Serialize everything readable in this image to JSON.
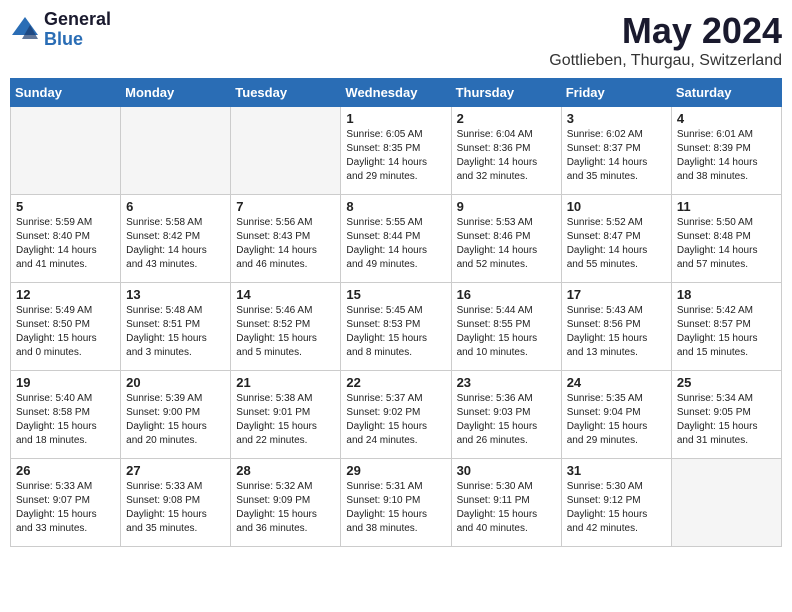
{
  "logo": {
    "general": "General",
    "blue": "Blue"
  },
  "title": "May 2024",
  "location": "Gottlieben, Thurgau, Switzerland",
  "days_header": [
    "Sunday",
    "Monday",
    "Tuesday",
    "Wednesday",
    "Thursday",
    "Friday",
    "Saturday"
  ],
  "weeks": [
    [
      {
        "num": "",
        "info": ""
      },
      {
        "num": "",
        "info": ""
      },
      {
        "num": "",
        "info": ""
      },
      {
        "num": "1",
        "info": "Sunrise: 6:05 AM\nSunset: 8:35 PM\nDaylight: 14 hours\nand 29 minutes."
      },
      {
        "num": "2",
        "info": "Sunrise: 6:04 AM\nSunset: 8:36 PM\nDaylight: 14 hours\nand 32 minutes."
      },
      {
        "num": "3",
        "info": "Sunrise: 6:02 AM\nSunset: 8:37 PM\nDaylight: 14 hours\nand 35 minutes."
      },
      {
        "num": "4",
        "info": "Sunrise: 6:01 AM\nSunset: 8:39 PM\nDaylight: 14 hours\nand 38 minutes."
      }
    ],
    [
      {
        "num": "5",
        "info": "Sunrise: 5:59 AM\nSunset: 8:40 PM\nDaylight: 14 hours\nand 41 minutes."
      },
      {
        "num": "6",
        "info": "Sunrise: 5:58 AM\nSunset: 8:42 PM\nDaylight: 14 hours\nand 43 minutes."
      },
      {
        "num": "7",
        "info": "Sunrise: 5:56 AM\nSunset: 8:43 PM\nDaylight: 14 hours\nand 46 minutes."
      },
      {
        "num": "8",
        "info": "Sunrise: 5:55 AM\nSunset: 8:44 PM\nDaylight: 14 hours\nand 49 minutes."
      },
      {
        "num": "9",
        "info": "Sunrise: 5:53 AM\nSunset: 8:46 PM\nDaylight: 14 hours\nand 52 minutes."
      },
      {
        "num": "10",
        "info": "Sunrise: 5:52 AM\nSunset: 8:47 PM\nDaylight: 14 hours\nand 55 minutes."
      },
      {
        "num": "11",
        "info": "Sunrise: 5:50 AM\nSunset: 8:48 PM\nDaylight: 14 hours\nand 57 minutes."
      }
    ],
    [
      {
        "num": "12",
        "info": "Sunrise: 5:49 AM\nSunset: 8:50 PM\nDaylight: 15 hours\nand 0 minutes."
      },
      {
        "num": "13",
        "info": "Sunrise: 5:48 AM\nSunset: 8:51 PM\nDaylight: 15 hours\nand 3 minutes."
      },
      {
        "num": "14",
        "info": "Sunrise: 5:46 AM\nSunset: 8:52 PM\nDaylight: 15 hours\nand 5 minutes."
      },
      {
        "num": "15",
        "info": "Sunrise: 5:45 AM\nSunset: 8:53 PM\nDaylight: 15 hours\nand 8 minutes."
      },
      {
        "num": "16",
        "info": "Sunrise: 5:44 AM\nSunset: 8:55 PM\nDaylight: 15 hours\nand 10 minutes."
      },
      {
        "num": "17",
        "info": "Sunrise: 5:43 AM\nSunset: 8:56 PM\nDaylight: 15 hours\nand 13 minutes."
      },
      {
        "num": "18",
        "info": "Sunrise: 5:42 AM\nSunset: 8:57 PM\nDaylight: 15 hours\nand 15 minutes."
      }
    ],
    [
      {
        "num": "19",
        "info": "Sunrise: 5:40 AM\nSunset: 8:58 PM\nDaylight: 15 hours\nand 18 minutes."
      },
      {
        "num": "20",
        "info": "Sunrise: 5:39 AM\nSunset: 9:00 PM\nDaylight: 15 hours\nand 20 minutes."
      },
      {
        "num": "21",
        "info": "Sunrise: 5:38 AM\nSunset: 9:01 PM\nDaylight: 15 hours\nand 22 minutes."
      },
      {
        "num": "22",
        "info": "Sunrise: 5:37 AM\nSunset: 9:02 PM\nDaylight: 15 hours\nand 24 minutes."
      },
      {
        "num": "23",
        "info": "Sunrise: 5:36 AM\nSunset: 9:03 PM\nDaylight: 15 hours\nand 26 minutes."
      },
      {
        "num": "24",
        "info": "Sunrise: 5:35 AM\nSunset: 9:04 PM\nDaylight: 15 hours\nand 29 minutes."
      },
      {
        "num": "25",
        "info": "Sunrise: 5:34 AM\nSunset: 9:05 PM\nDaylight: 15 hours\nand 31 minutes."
      }
    ],
    [
      {
        "num": "26",
        "info": "Sunrise: 5:33 AM\nSunset: 9:07 PM\nDaylight: 15 hours\nand 33 minutes."
      },
      {
        "num": "27",
        "info": "Sunrise: 5:33 AM\nSunset: 9:08 PM\nDaylight: 15 hours\nand 35 minutes."
      },
      {
        "num": "28",
        "info": "Sunrise: 5:32 AM\nSunset: 9:09 PM\nDaylight: 15 hours\nand 36 minutes."
      },
      {
        "num": "29",
        "info": "Sunrise: 5:31 AM\nSunset: 9:10 PM\nDaylight: 15 hours\nand 38 minutes."
      },
      {
        "num": "30",
        "info": "Sunrise: 5:30 AM\nSunset: 9:11 PM\nDaylight: 15 hours\nand 40 minutes."
      },
      {
        "num": "31",
        "info": "Sunrise: 5:30 AM\nSunset: 9:12 PM\nDaylight: 15 hours\nand 42 minutes."
      },
      {
        "num": "",
        "info": ""
      }
    ]
  ]
}
